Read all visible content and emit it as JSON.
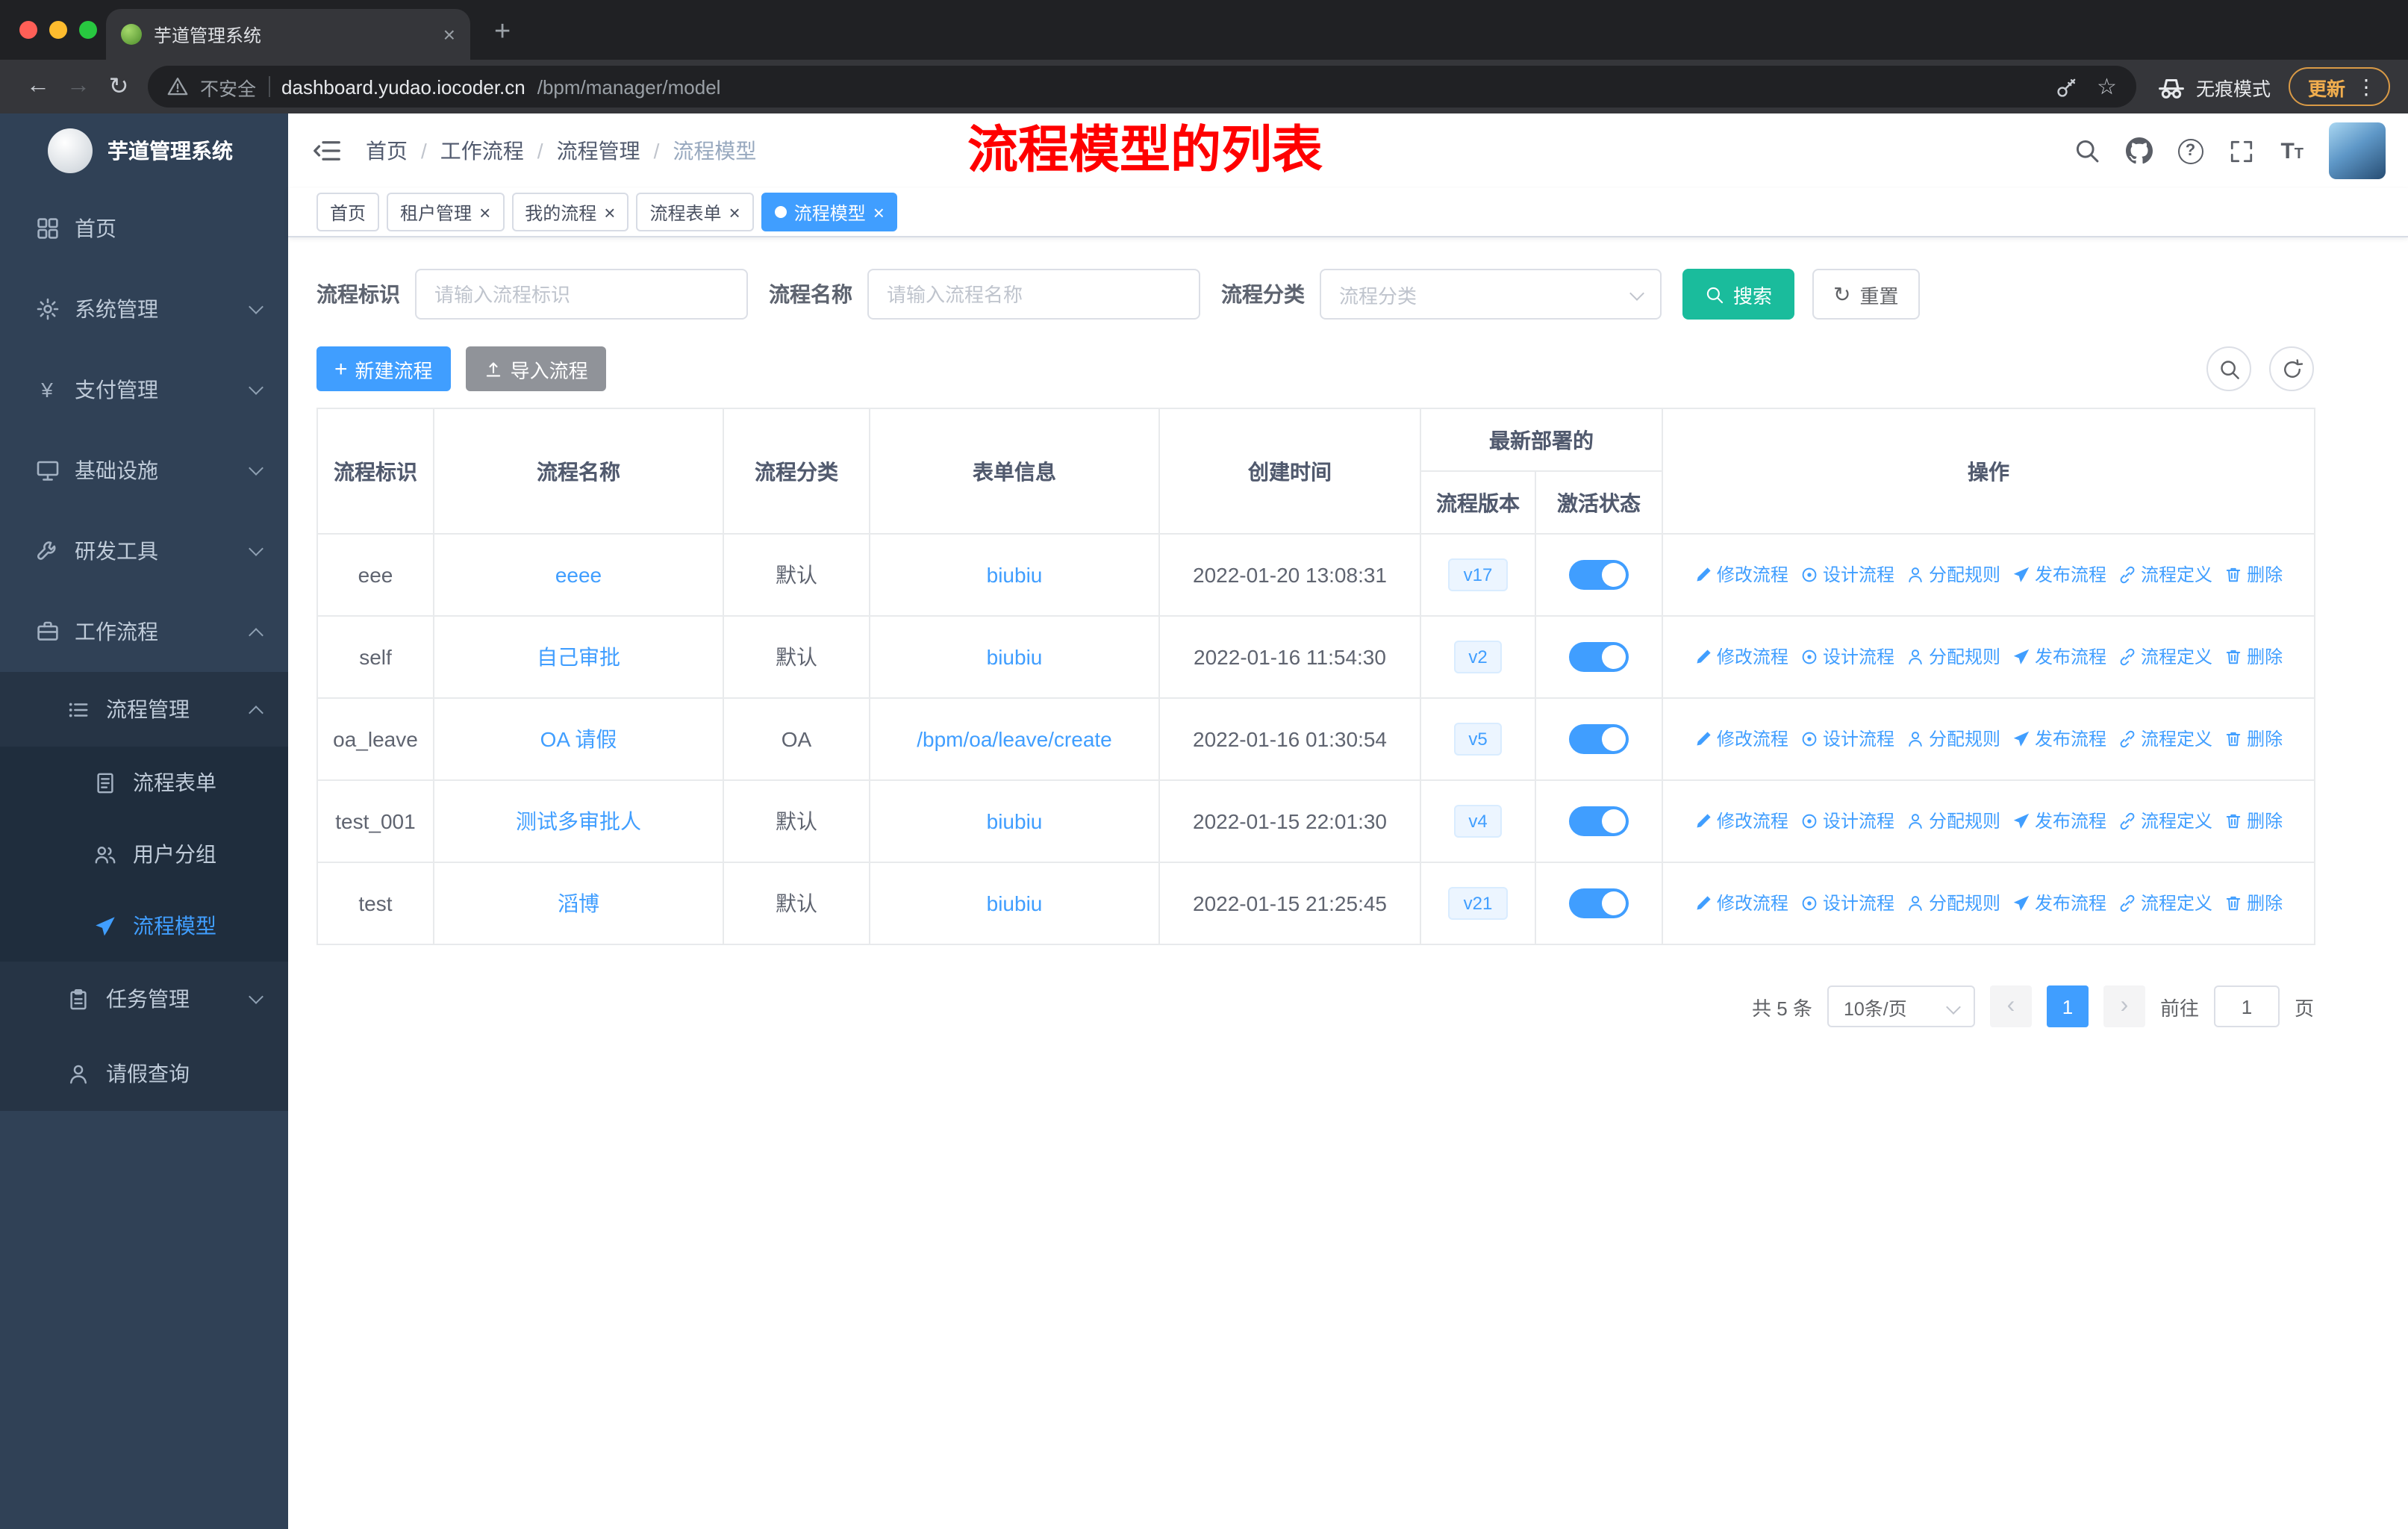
{
  "browser": {
    "tab_title": "芋道管理系统",
    "security_label": "不安全",
    "url_host": "dashboard.yudao.iocoder.cn",
    "url_path": "/bpm/manager/model",
    "incognito_label": "无痕模式",
    "update_label": "更新"
  },
  "glyphs": {
    "back": "←",
    "forward": "→",
    "reload": "↻",
    "star": "☆",
    "kebab": "⋮",
    "new_tab": "+",
    "close": "×",
    "question": "?",
    "yen": "¥",
    "plus": "+",
    "prev": "‹",
    "next": "›",
    "font_large": "T",
    "font_small": "T"
  },
  "sidebar": {
    "logo_title": "芋道管理系统",
    "items": [
      {
        "label": "首页",
        "icon": "dashboard-icon"
      },
      {
        "label": "系统管理",
        "icon": "gear-icon"
      },
      {
        "label": "支付管理",
        "icon": "yen-icon"
      },
      {
        "label": "基础设施",
        "icon": "monitor-icon"
      },
      {
        "label": "研发工具",
        "icon": "tool-icon"
      },
      {
        "label": "工作流程",
        "icon": "briefcase-icon"
      }
    ],
    "process_group": {
      "label": "流程管理",
      "children": [
        {
          "label": "流程表单",
          "icon": "document-icon"
        },
        {
          "label": "用户分组",
          "icon": "users-icon"
        },
        {
          "label": "流程模型",
          "icon": "send-icon",
          "active": true
        }
      ]
    },
    "task_group": {
      "label": "任务管理",
      "icon": "clipboard-icon"
    },
    "leave_item": {
      "label": "请假查询",
      "icon": "person-icon"
    }
  },
  "header": {
    "breadcrumb": [
      "首页",
      "工作流程",
      "流程管理",
      "流程模型"
    ],
    "annotation": "流程模型的列表"
  },
  "tags": {
    "items": [
      {
        "label": "首页",
        "closable": false,
        "active": false
      },
      {
        "label": "租户管理",
        "closable": true,
        "active": false
      },
      {
        "label": "我的流程",
        "closable": true,
        "active": false
      },
      {
        "label": "流程表单",
        "closable": true,
        "active": false
      },
      {
        "label": "流程模型",
        "closable": true,
        "active": true
      }
    ]
  },
  "filters": {
    "id_label": "流程标识",
    "id_placeholder": "请输入流程标识",
    "name_label": "流程名称",
    "name_placeholder": "请输入流程名称",
    "category_label": "流程分类",
    "category_placeholder": "流程分类",
    "search_label": "搜索",
    "reset_label": "重置"
  },
  "actions": {
    "create_label": "新建流程",
    "import_label": "导入流程"
  },
  "table": {
    "headers": {
      "id": "流程标识",
      "name": "流程名称",
      "category": "流程分类",
      "form": "表单信息",
      "created": "创建时间",
      "deployment_group": "最新部署的",
      "version": "流程版本",
      "status": "激活状态",
      "actions": "操作"
    },
    "ops": [
      "修改流程",
      "设计流程",
      "分配规则",
      "发布流程",
      "流程定义",
      "删除"
    ],
    "rows": [
      {
        "id": "eee",
        "name": "eeee",
        "category": "默认",
        "form": "biubiu",
        "created": "2022-01-20 13:08:31",
        "version": "v17",
        "active": true
      },
      {
        "id": "self",
        "name": "自己审批",
        "category": "默认",
        "form": "biubiu",
        "created": "2022-01-16 11:54:30",
        "version": "v2",
        "active": true
      },
      {
        "id": "oa_leave",
        "name": "OA 请假",
        "category": "OA",
        "form": "/bpm/oa/leave/create",
        "created": "2022-01-16 01:30:54",
        "version": "v5",
        "active": true
      },
      {
        "id": "test_001",
        "name": "测试多审批人",
        "category": "默认",
        "form": "biubiu",
        "created": "2022-01-15 22:01:30",
        "version": "v4",
        "active": true
      },
      {
        "id": "test",
        "name": "滔博",
        "category": "默认",
        "form": "biubiu",
        "created": "2022-01-15 21:25:45",
        "version": "v21",
        "active": true
      }
    ]
  },
  "pagination": {
    "total": "共 5 条",
    "page_size": "10条/页",
    "current_page": "1",
    "goto_prefix": "前往",
    "goto_value": "1",
    "goto_suffix": "页"
  },
  "colors": {
    "primary": "#409EFF",
    "search_button": "#1ABC9C",
    "annotation_red": "#FF0000",
    "sidebar_bg": "#304156",
    "sidebar_submenu_bg": "#263445",
    "sidebar_deep_bg": "#1F2D3D",
    "import_button": "#909399",
    "toggle_on": "#409EFF",
    "version_tag_bg": "#ECF5FF"
  }
}
